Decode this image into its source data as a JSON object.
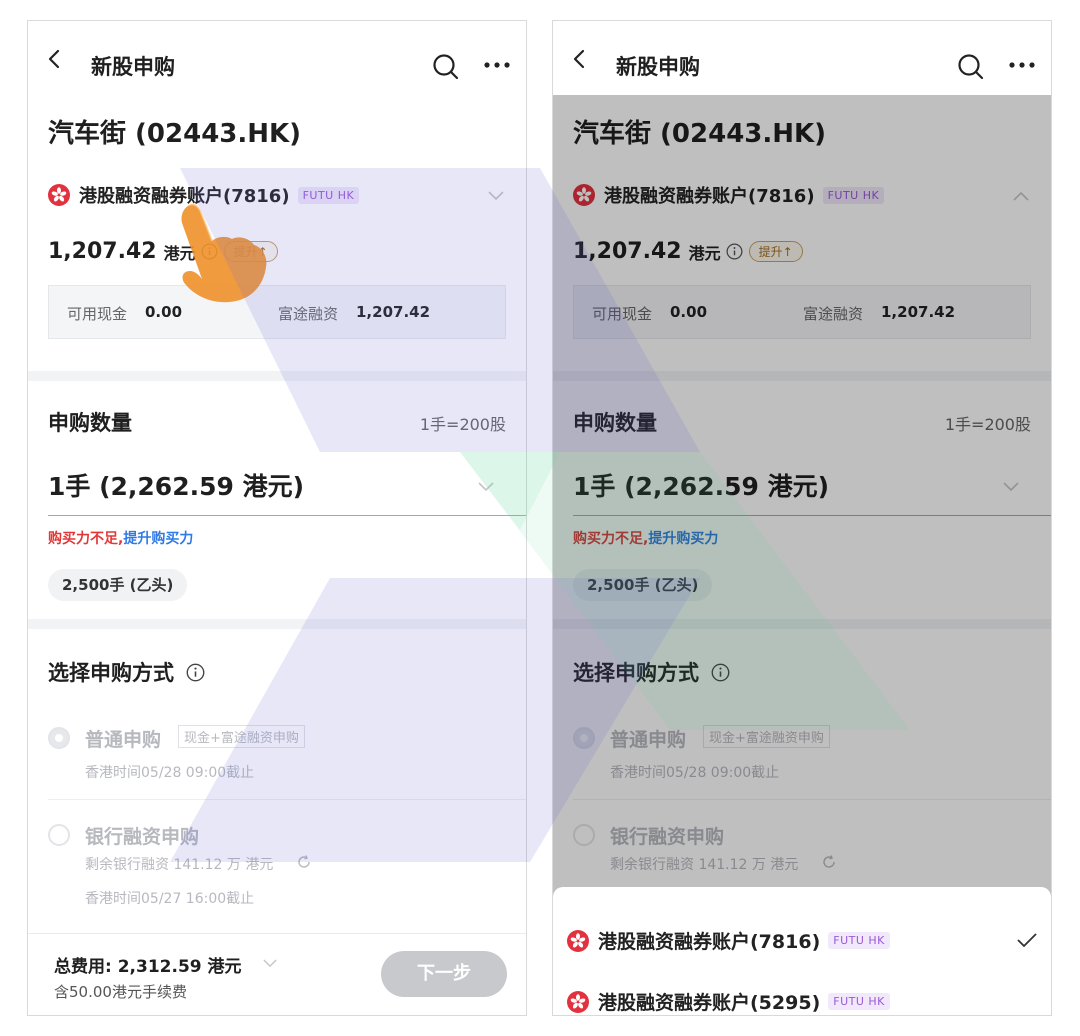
{
  "nav": {
    "title": "新股申购"
  },
  "stock": {
    "name": "汽车街 (02443.HK)"
  },
  "account": {
    "name": "港股融资融券账户(7816)",
    "badge": "FUTU HK"
  },
  "balance": {
    "amount": "1,207.42",
    "unit": "港元",
    "upgrade": "提升↑"
  },
  "cash": {
    "available_label": "可用现金",
    "available_value": "0.00",
    "margin_label": "富途融资",
    "margin_value": "1,207.42"
  },
  "quantity": {
    "title": "申购数量",
    "lot_info": "1手=200股",
    "value": "1手 (2,262.59 港元)",
    "warn_red": "购买力不足,",
    "warn_blue": "提升购买力",
    "chip": "2,500手 (乙头)"
  },
  "method": {
    "title": "选择申购方式",
    "normal": {
      "name": "普通申购",
      "tag": "现金+富途融资申购",
      "deadline": "香港时间05/28 09:00截止"
    },
    "bank": {
      "name": "银行融资申购",
      "remaining": "剩余银行融资 141.12 万 港元",
      "deadline": "香港时间05/27 16:00截止"
    }
  },
  "footer": {
    "total": "总费用: 2,312.59 港元",
    "fee": "含50.00港元手续费",
    "next": "下一步"
  },
  "sheet": {
    "accounts": [
      {
        "name": "港股融资融券账户(7816)",
        "badge": "FUTU HK",
        "selected": true
      },
      {
        "name": "港股融资融券账户(5295)",
        "badge": "FUTU HK",
        "selected": false
      }
    ]
  },
  "colors": {
    "accent_blue": "#2f7ae5",
    "warning_red": "#e33737",
    "badge_purple": "#9a5ad6",
    "hk_red": "#e3323f"
  }
}
